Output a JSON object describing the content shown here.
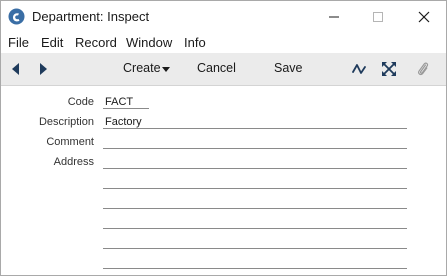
{
  "window": {
    "title": "Department: Inspect"
  },
  "menu": [
    "File",
    "Edit",
    "Record",
    "Window",
    "Info"
  ],
  "toolbar": {
    "create_label": "Create",
    "cancel_label": "Cancel",
    "save_label": "Save"
  },
  "form": {
    "code_label": "Code",
    "code_value": "FACT",
    "description_label": "Description",
    "description_value": "Factory",
    "comment_label": "Comment",
    "comment_value": "",
    "address_label": "Address",
    "address_lines": [
      "",
      "",
      "",
      "",
      "",
      ""
    ]
  },
  "colors": {
    "app_icon": "#3a6ea5",
    "toolbar_bg": "#ebebeb",
    "attachment_icon": "#9a9a9a"
  }
}
